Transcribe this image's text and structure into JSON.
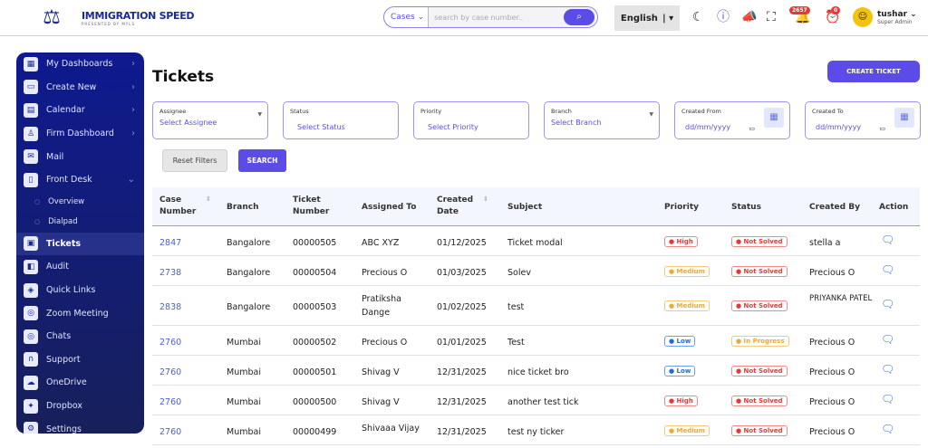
{
  "header": {
    "logo_title": "IMMIGRATION SPEED",
    "logo_subtitle": "PRESENTED BY MYLS",
    "search_scope": "Cases",
    "search_placeholder": "search by case number..",
    "language": "English",
    "notifications_count": "2657",
    "reminders_count": "0",
    "user_name": "tushar",
    "user_role": "Super Admin"
  },
  "sidebar": {
    "items": [
      {
        "label": "My Dashboards",
        "icon": "grid-icon",
        "chevron": "›"
      },
      {
        "label": "Create New",
        "icon": "folder-icon",
        "chevron": "›"
      },
      {
        "label": "Calendar",
        "icon": "calendar-icon",
        "chevron": "›"
      },
      {
        "label": "Firm Dashboard",
        "icon": "stamp-icon",
        "chevron": "›"
      },
      {
        "label": "Mail",
        "icon": "mail-icon"
      },
      {
        "label": "Front Desk",
        "icon": "clipboard-icon",
        "chevron": "⌄"
      },
      {
        "label": "Overview",
        "sub": true
      },
      {
        "label": "Dialpad",
        "sub": true
      },
      {
        "label": "Tickets",
        "icon": "ticket-icon",
        "active": true
      },
      {
        "label": "Audit",
        "icon": "audit-icon"
      },
      {
        "label": "Quick Links",
        "icon": "layers-icon"
      },
      {
        "label": "Zoom Meeting",
        "icon": "chat-icon"
      },
      {
        "label": "Chats",
        "icon": "chat-icon"
      },
      {
        "label": "Support",
        "icon": "headset-icon"
      },
      {
        "label": "OneDrive",
        "icon": "cloud-icon"
      },
      {
        "label": "Dropbox",
        "icon": "dropbox-icon"
      },
      {
        "label": "Settings",
        "icon": "gear-icon"
      }
    ]
  },
  "main": {
    "title": "Tickets",
    "create_label": "CREATE TICKET",
    "filters": [
      {
        "label": "Assignee",
        "value": "Select Assignee"
      },
      {
        "label": "Status",
        "value": "Select Status"
      },
      {
        "label": "Priority",
        "value": "Select Priority"
      },
      {
        "label": "Branch",
        "value": "Select Branch"
      },
      {
        "label": "Created From",
        "value": "dd/mm/yyyy"
      },
      {
        "label": "Created To",
        "value": "dd/mm/yyyy"
      }
    ],
    "reset_label": "Reset Filters",
    "search_label": "SEARCH",
    "columns": [
      "Case Number",
      "Branch",
      "Ticket Number",
      "Assigned To",
      "Created Date",
      "Subject",
      "Priority",
      "Status",
      "Created By",
      "Action"
    ],
    "rows": [
      [
        "2847",
        "Bangalore",
        "00000505",
        "ABC XYZ",
        "01/12/2025",
        "Ticket modal",
        "High",
        "Not Solved",
        "stella a"
      ],
      [
        "2738",
        "Bangalore",
        "00000504",
        "Precious O",
        "01/03/2025",
        "Solev",
        "Medium",
        "Not Solved",
        "Precious O"
      ],
      [
        "2838",
        "Bangalore",
        "00000503",
        "Pratiksha Dange",
        "01/02/2025",
        "test",
        "Medium",
        "Not Solved",
        "PRIYANKA PATEL"
      ],
      [
        "2760",
        "Mumbai",
        "00000502",
        "Precious O",
        "01/01/2025",
        "Test",
        "Low",
        "In Progress",
        "Precious O"
      ],
      [
        "2760",
        "Mumbai",
        "00000501",
        "Shivag V",
        "12/31/2025",
        "nice ticket bro",
        "Low",
        "Not Solved",
        "Precious O"
      ],
      [
        "2760",
        "Mumbai",
        "00000500",
        "Shivag V",
        "12/31/2025",
        "another test tick",
        "High",
        "Not Solved",
        "Precious O"
      ],
      [
        "2760",
        "Mumbai",
        "00000499",
        "Shivaaa Vijay",
        "12/31/2025",
        "test ny ticker",
        "Medium",
        "Not Solved",
        "Precious O"
      ]
    ]
  },
  "colors": {
    "accent": "#5b4ce8",
    "sidebar": "#0e1a8f",
    "high": "#e53935",
    "medium": "#f0a830",
    "low": "#1e6ae0"
  }
}
